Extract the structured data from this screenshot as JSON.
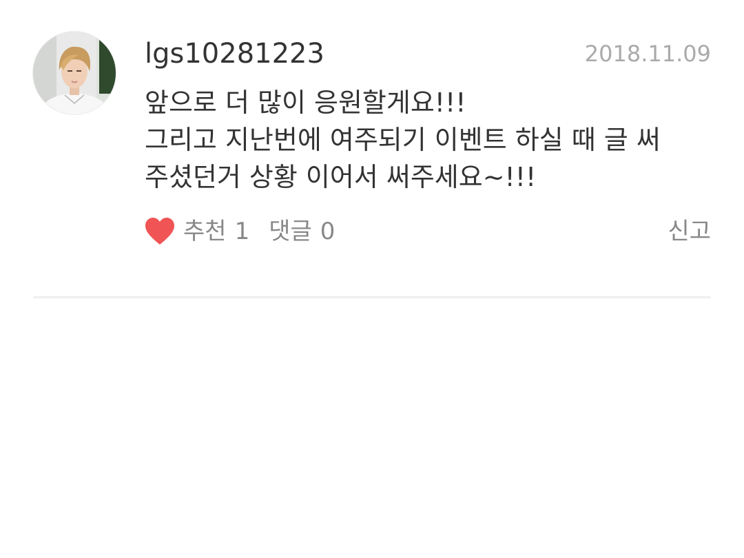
{
  "comment": {
    "username": "lgs10281223",
    "date": "2018.11.09",
    "body_lines": [
      "앞으로 더 많이 응원할게요!!!",
      "그리고 지난번에 여주되기 이벤트 하실 때 글 써",
      "주셨던거 상황 이어서 써주세요~!!!"
    ],
    "like": {
      "icon": "heart-icon",
      "label": "추천",
      "count": "1",
      "color": "#f05454"
    },
    "reply": {
      "label": "댓글",
      "count": "0"
    },
    "report_label": "신고"
  },
  "colors": {
    "text_primary": "#333333",
    "text_secondary": "#888888",
    "date": "#aaaaaa",
    "divider": "#eeeeee"
  }
}
